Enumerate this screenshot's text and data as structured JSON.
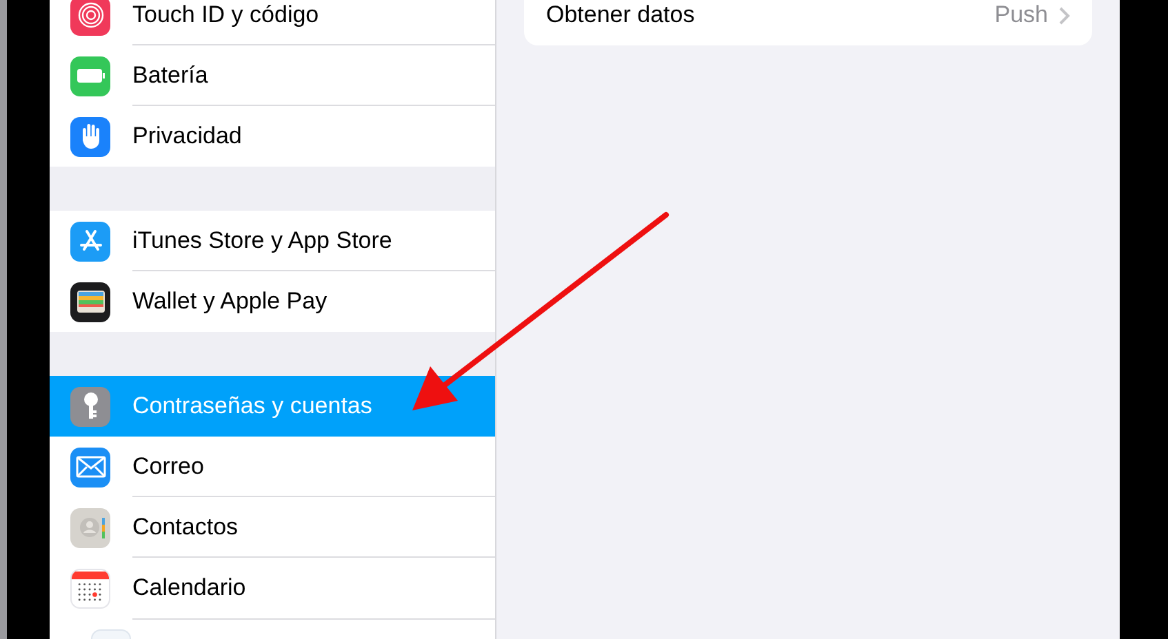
{
  "sidebar": {
    "groups": [
      {
        "items": [
          {
            "label": "Touch ID y código",
            "selected": false
          },
          {
            "label": "Batería",
            "selected": false
          },
          {
            "label": "Privacidad",
            "selected": false
          }
        ]
      },
      {
        "items": [
          {
            "label": "iTunes Store y App Store",
            "selected": false
          },
          {
            "label": "Wallet y Apple Pay",
            "selected": false
          }
        ]
      },
      {
        "items": [
          {
            "label": "Contraseñas y cuentas",
            "selected": true
          },
          {
            "label": "Correo",
            "selected": false
          },
          {
            "label": "Contactos",
            "selected": false
          },
          {
            "label": "Calendario",
            "selected": false
          }
        ]
      }
    ]
  },
  "detail": {
    "rows": [
      {
        "label": "Obtener datos",
        "value": "Push"
      }
    ]
  }
}
